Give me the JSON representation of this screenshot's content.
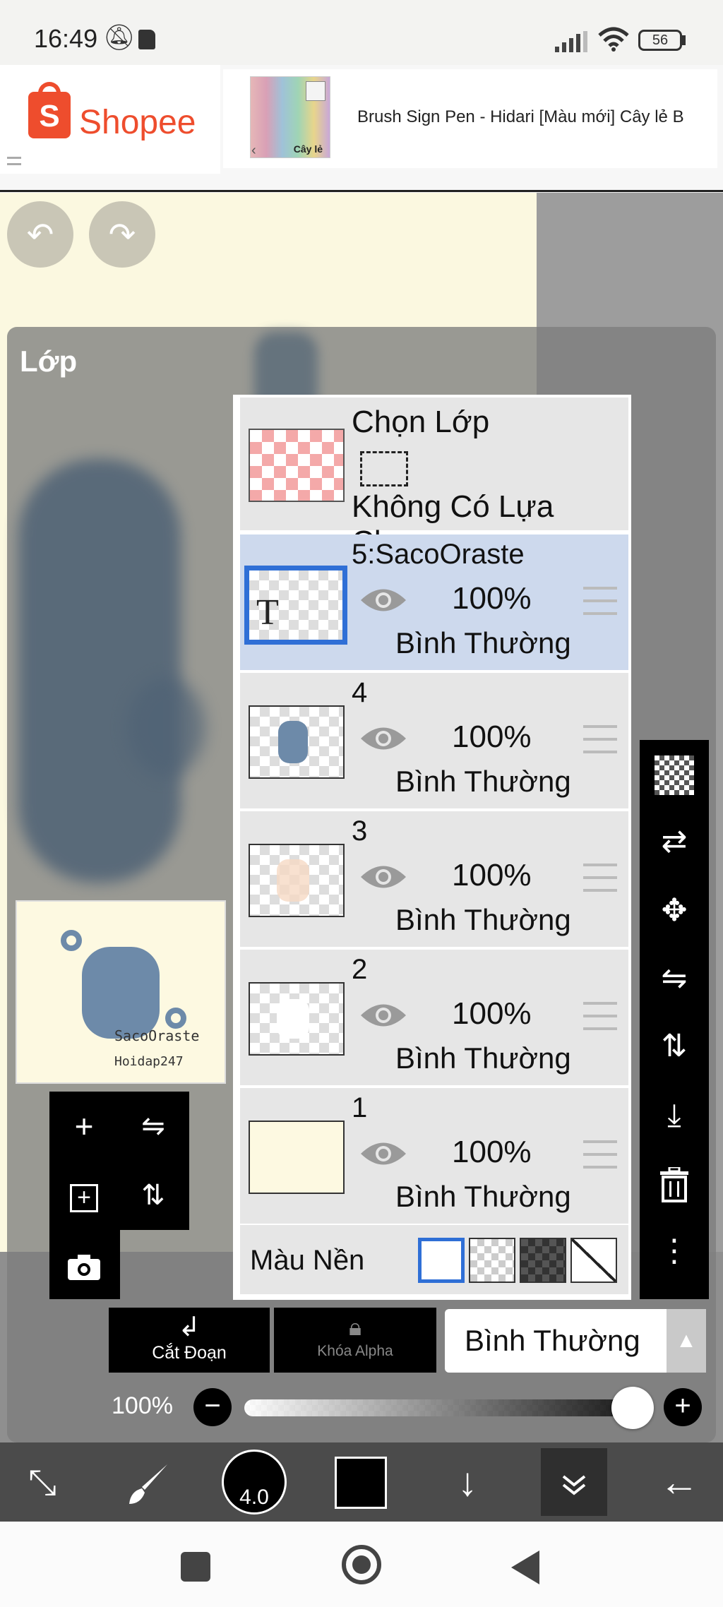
{
  "status_bar": {
    "time": "16:49",
    "battery": "56"
  },
  "ad": {
    "brand": "Shopee",
    "product_thumb_label": "Cây lẻ",
    "product_text": "Brush Sign Pen - Hidari    [Màu mới] Cây lẻ B"
  },
  "panel": {
    "title": "Lớp"
  },
  "preview": {
    "line1": "SacoOraste",
    "line2": "Hoidap247"
  },
  "selection_row": {
    "title": "Chọn Lớp",
    "subtitle": "Không Có Lựa Chọn"
  },
  "layers": [
    {
      "name": "5:SacoOraste",
      "opacity": "100%",
      "blend": "Bình Thường",
      "selected": true
    },
    {
      "name": "4",
      "opacity": "100%",
      "blend": "Bình Thường",
      "selected": false
    },
    {
      "name": "3",
      "opacity": "100%",
      "blend": "Bình Thường",
      "selected": false
    },
    {
      "name": "2",
      "opacity": "100%",
      "blend": "Bình Thường",
      "selected": false
    },
    {
      "name": "1",
      "opacity": "100%",
      "blend": "Bình Thường",
      "selected": false
    }
  ],
  "background_row": {
    "label": "Màu Nền"
  },
  "controls": {
    "cut_label": "Cắt Đoạn",
    "alpha_label": "Khóa Alpha",
    "blend_value": "Bình Thường",
    "opacity_label": "100%",
    "opacity_value": 1.0
  },
  "toolbar": {
    "brush_size": "4.0",
    "color": "#000000"
  },
  "colors": {
    "accent": "#2f6fd6",
    "selected_row": "#cdd9ed",
    "shopee": "#ee4d2d"
  }
}
